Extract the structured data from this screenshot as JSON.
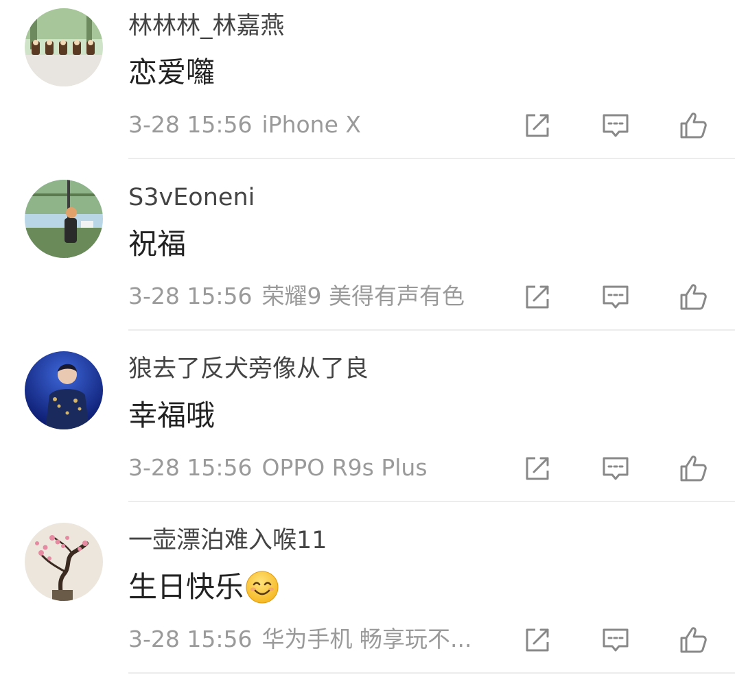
{
  "comments": [
    {
      "username": "林林林_林嘉燕",
      "text": "恋爱囖",
      "time": "3-28 15:56",
      "device": "iPhone X",
      "avatar_icon": "park-figurines-avatar",
      "colors": {
        "sky": "#cfe3c8",
        "ground": "#e8e4df"
      }
    },
    {
      "username": "S3vEoneni",
      "text": "祝福",
      "time": "3-28 15:56",
      "device": "荣耀9 美得有声有色",
      "avatar_icon": "person-in-park-avatar",
      "colors": {
        "sky": "#b9d6e6",
        "ground": "#6a8a5a"
      }
    },
    {
      "username": "狼去了反犬旁像从了良",
      "text": "幸福哦",
      "time": "3-28 15:56",
      "device": "OPPO R9s Plus",
      "avatar_icon": "stage-performer-avatar",
      "colors": {
        "sky": "#1f3fa8",
        "ground": "#0b1a6e"
      }
    },
    {
      "username": "一壶漂泊难入喉11",
      "text": "生日快乐",
      "emoji": "smiling-face-emoji",
      "time": "3-28 15:56",
      "device": "华为手机 畅享玩不...",
      "avatar_icon": "plum-blossom-avatar",
      "colors": {
        "sky": "#ece6dd",
        "ground": "#d9d2c6"
      }
    }
  ],
  "actions": {
    "repost_icon": "repost-icon",
    "comment_icon": "comment-icon",
    "like_icon": "like-icon"
  },
  "theme": {
    "text_primary": "#222222",
    "text_secondary": "#444444",
    "text_meta": "#9a9a9a",
    "icon_color": "#888888",
    "divider": "#ececec"
  }
}
